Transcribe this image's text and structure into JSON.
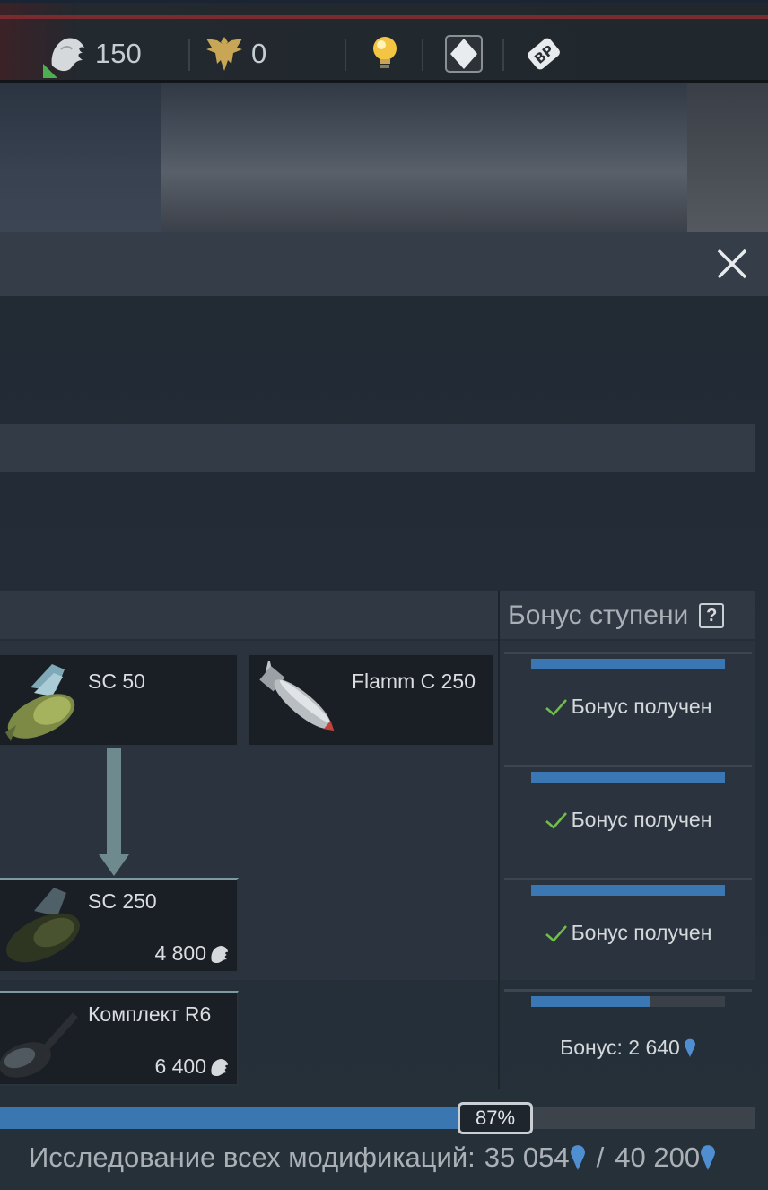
{
  "currencies": {
    "silver_lions": "150",
    "golden_eagles": "0"
  },
  "icons": {
    "lion": "silver-lion-icon",
    "eagle": "golden-eagle-icon",
    "bulb": "lightbulb-icon",
    "diamond": "premium-diamond-icon",
    "bp": "battle-pass-icon",
    "close": "close-icon",
    "research_point": "research-point-icon"
  },
  "colors": {
    "accent_blue": "#3b78b3",
    "check_green": "#6fbf4a"
  },
  "table": {
    "bonus_header": "Бонус ступени",
    "help": "?"
  },
  "modules": {
    "sc50": {
      "name": "SC 50"
    },
    "flamm": {
      "name": "Flamm C 250"
    },
    "sc250": {
      "name": "SC 250",
      "cost": "4 800"
    },
    "r6": {
      "name": "Комплект R6",
      "cost": "6 400"
    }
  },
  "bonuses": [
    {
      "text": "Бонус получен",
      "progress": 1.0
    },
    {
      "text": "Бонус получен",
      "progress": 1.0
    },
    {
      "text": "Бонус получен",
      "progress": 1.0
    },
    {
      "text": "Бонус: 2 640",
      "progress": 0.61
    }
  ],
  "research": {
    "percent_label": "87%",
    "progress": 0.87,
    "label": "Исследование всех модификаций:",
    "current": "35 054",
    "slash": "/",
    "total": "40 200"
  }
}
